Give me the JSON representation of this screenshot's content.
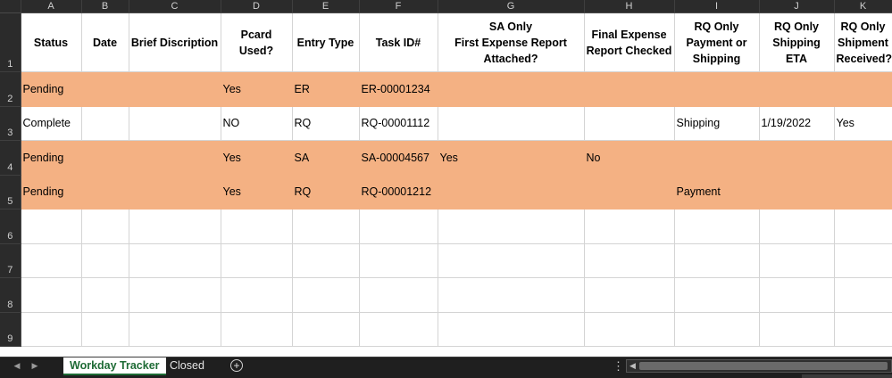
{
  "columns": [
    "A",
    "B",
    "C",
    "D",
    "E",
    "F",
    "G",
    "H",
    "I",
    "J",
    "K"
  ],
  "header_row": {
    "row_num": "1",
    "cells": [
      "Status",
      "Date",
      "Brief Discription",
      "Pcard Used?",
      "Entry Type",
      "Task ID#",
      "SA Only\nFirst Expense Report Attached?",
      "Final Expense Report Checked",
      "RQ Only Payment or Shipping",
      "RQ Only Shipping ETA",
      "RQ Only Shipment Received?"
    ]
  },
  "rows": [
    {
      "row_num": "2",
      "highlight": true,
      "cells": [
        "Pending",
        "",
        "",
        "Yes",
        "ER",
        "ER-00001234",
        "",
        "",
        "",
        "",
        ""
      ]
    },
    {
      "row_num": "3",
      "highlight": false,
      "cells": [
        "Complete",
        "",
        "",
        "NO",
        "RQ",
        "RQ-00001112",
        "",
        "",
        "Shipping",
        "1/19/2022",
        "Yes"
      ]
    },
    {
      "row_num": "4",
      "highlight": true,
      "cells": [
        "Pending",
        "",
        "",
        "Yes",
        "SA",
        "SA-00004567",
        "Yes",
        "No",
        "",
        "",
        ""
      ]
    },
    {
      "row_num": "5",
      "highlight": true,
      "cells": [
        "Pending",
        "",
        "",
        "Yes",
        "RQ",
        "RQ-00001212",
        "",
        "",
        "Payment",
        "",
        ""
      ]
    },
    {
      "row_num": "6",
      "highlight": false,
      "cells": [
        "",
        "",
        "",
        "",
        "",
        "",
        "",
        "",
        "",
        "",
        ""
      ]
    },
    {
      "row_num": "7",
      "highlight": false,
      "cells": [
        "",
        "",
        "",
        "",
        "",
        "",
        "",
        "",
        "",
        "",
        ""
      ]
    },
    {
      "row_num": "8",
      "highlight": false,
      "cells": [
        "",
        "",
        "",
        "",
        "",
        "",
        "",
        "",
        "",
        "",
        ""
      ]
    },
    {
      "row_num": "9",
      "highlight": false,
      "cells": [
        "",
        "",
        "",
        "",
        "",
        "",
        "",
        "",
        "",
        "",
        ""
      ]
    }
  ],
  "sheet_tabs": [
    {
      "label": "Workday Tracker",
      "active": true
    },
    {
      "label": "Closed",
      "active": false
    }
  ],
  "icons": {
    "prev_sheet": "caret-left-icon",
    "next_sheet": "caret-right-icon",
    "add_sheet": "plus-circle-icon",
    "more_options": "vertical-ellipsis-icon"
  },
  "colors": {
    "pending_fill": "#f4b183",
    "active_tab_text": "#1e6b35",
    "header_bg": "#2b2b2b"
  }
}
